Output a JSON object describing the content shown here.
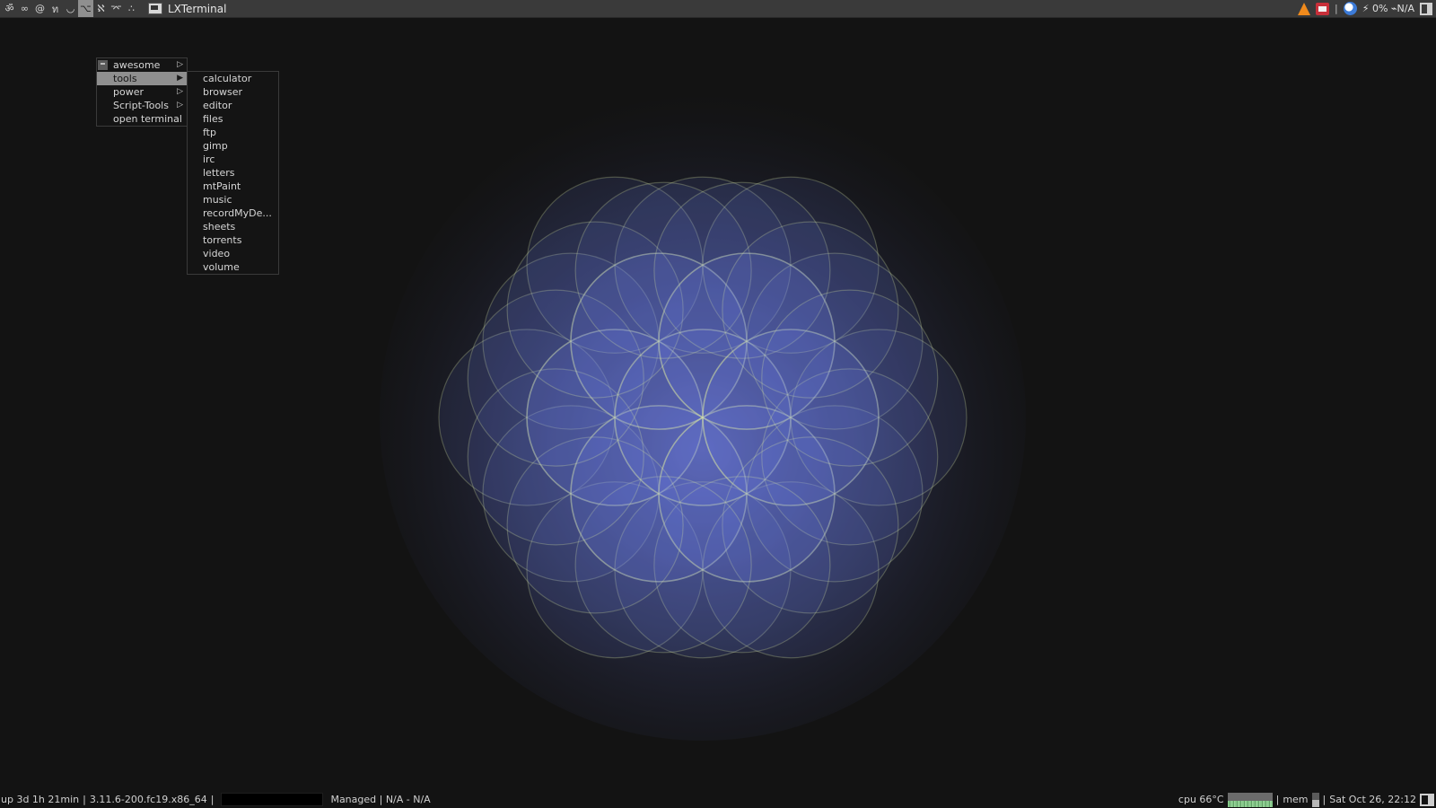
{
  "topbar": {
    "tags": [
      "ॐ",
      "∞",
      "@",
      "ท",
      "◡",
      "⌥",
      "ℵ",
      "⌤",
      "∴"
    ],
    "active_tag_index": 5,
    "task_title": "LXTerminal",
    "tray_status": "⚡ 0% ⌁N/A"
  },
  "menu": {
    "main_items": [
      {
        "label": "awesome",
        "has_submenu": true
      },
      {
        "label": "tools",
        "has_submenu": true,
        "selected": true
      },
      {
        "label": "power",
        "has_submenu": true
      },
      {
        "label": "Script-Tools",
        "has_submenu": true
      },
      {
        "label": "open terminal",
        "has_submenu": false
      }
    ],
    "sub_items": [
      "calculator",
      "browser",
      "editor",
      "files",
      "ftp",
      "gimp",
      "irc",
      "letters",
      "mtPaint",
      "music",
      "recordMyDe...",
      "sheets",
      "torrents",
      "video",
      "volume"
    ]
  },
  "bottombar": {
    "uptime": "up 3d 1h 21min",
    "kernel": "3.11.6-200.fc19.x86_64",
    "sep": "|",
    "managed": "Managed | N/A - N/A",
    "cpu": "cpu 66°C",
    "mem": "mem",
    "datetime": "Sat Oct 26, 22:12",
    "mem_fill_fraction": 0.5
  },
  "colors": {
    "bar_bg": "#3a3a3a",
    "selected_bg": "#8f8f8f",
    "wallpaper_fill": "#6f7ff0",
    "wallpaper_stroke": "#d9e6a0"
  }
}
